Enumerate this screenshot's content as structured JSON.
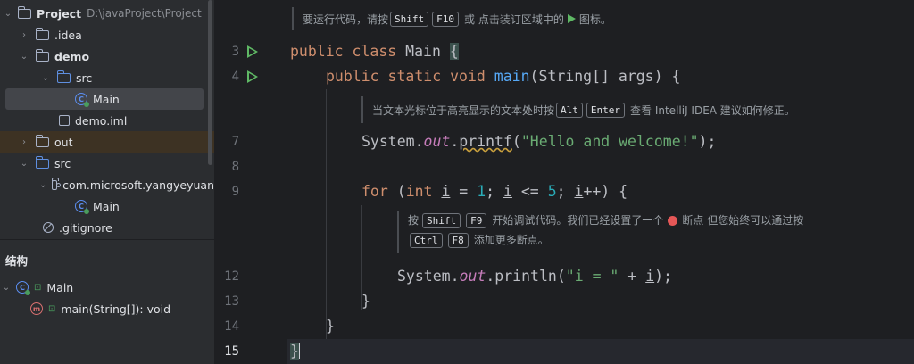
{
  "project_tree": {
    "root_label": "Project",
    "root_path": "D:\\javaProject\\Project",
    "items": [
      {
        "label": ".idea"
      },
      {
        "label": "demo"
      },
      {
        "label": "src"
      },
      {
        "label": "Main"
      },
      {
        "label": "demo.iml"
      },
      {
        "label": "out"
      },
      {
        "label": "src"
      },
      {
        "label": "com.microsoft.yangyeyuan"
      },
      {
        "label": "Main"
      },
      {
        "label": ".gitignore"
      }
    ]
  },
  "structure": {
    "title": "结构",
    "class_label": "Main",
    "method_label": "main(String[]): void"
  },
  "editor": {
    "line_numbers": [
      "3",
      "4",
      "7",
      "8",
      "9",
      "12",
      "13",
      "14",
      "15"
    ],
    "code": {
      "l3_kw1": "public",
      "l3_kw2": "class",
      "l3_name": " Main ",
      "l3_brace": "{",
      "l4_kw1": "public",
      "l4_kw2": "static",
      "l4_kw3": "void",
      "l4_fn": "main",
      "l4_rest": "(String[] args) {",
      "l7_a": "System.",
      "l7_out": "out",
      "l7_dot": ".",
      "l7_fn": "printf",
      "l7_open": "(",
      "l7_str": "\"Hello and welcome!\"",
      "l7_end": ");",
      "l9_for": "for",
      "l9_a": " (",
      "l9_int": "int",
      "l9_i1": "i",
      "l9_eq": " = ",
      "l9_n1": "1",
      "l9_semi": "; ",
      "l9_i2": "i",
      "l9_lt": " <= ",
      "l9_n5": "5",
      "l9_semi2": "; ",
      "l9_i3": "i",
      "l9_end": "++) {",
      "l12_a": "System.",
      "l12_out": "out",
      "l12_b": ".println(",
      "l12_str": "\"i = \"",
      "l12_plus": " + ",
      "l12_i": "i",
      "l12_end": ");",
      "l13": "}",
      "l14": "}",
      "l15": "}"
    },
    "doc1": {
      "pre": "要运行代码，请按",
      "k1": "Shift",
      "k2": "F10",
      "post": "或 点击装订区域中的",
      "post2": "图标。"
    },
    "doc2": {
      "pre": "当文本光标位于高亮显示的文本处时按",
      "k1": "Alt",
      "k2": "Enter",
      "post": "查看 IntelliJ IDEA 建议如何修正。"
    },
    "doc3": {
      "pre": "按",
      "k1": "Shift",
      "k2": "F9",
      "mid": "开始调试代码。我们已经设置了一个",
      "post": "断点 但您始终可以通过按",
      "k3": "Ctrl",
      "k4": "F8",
      "post2": "添加更多断点。"
    }
  }
}
